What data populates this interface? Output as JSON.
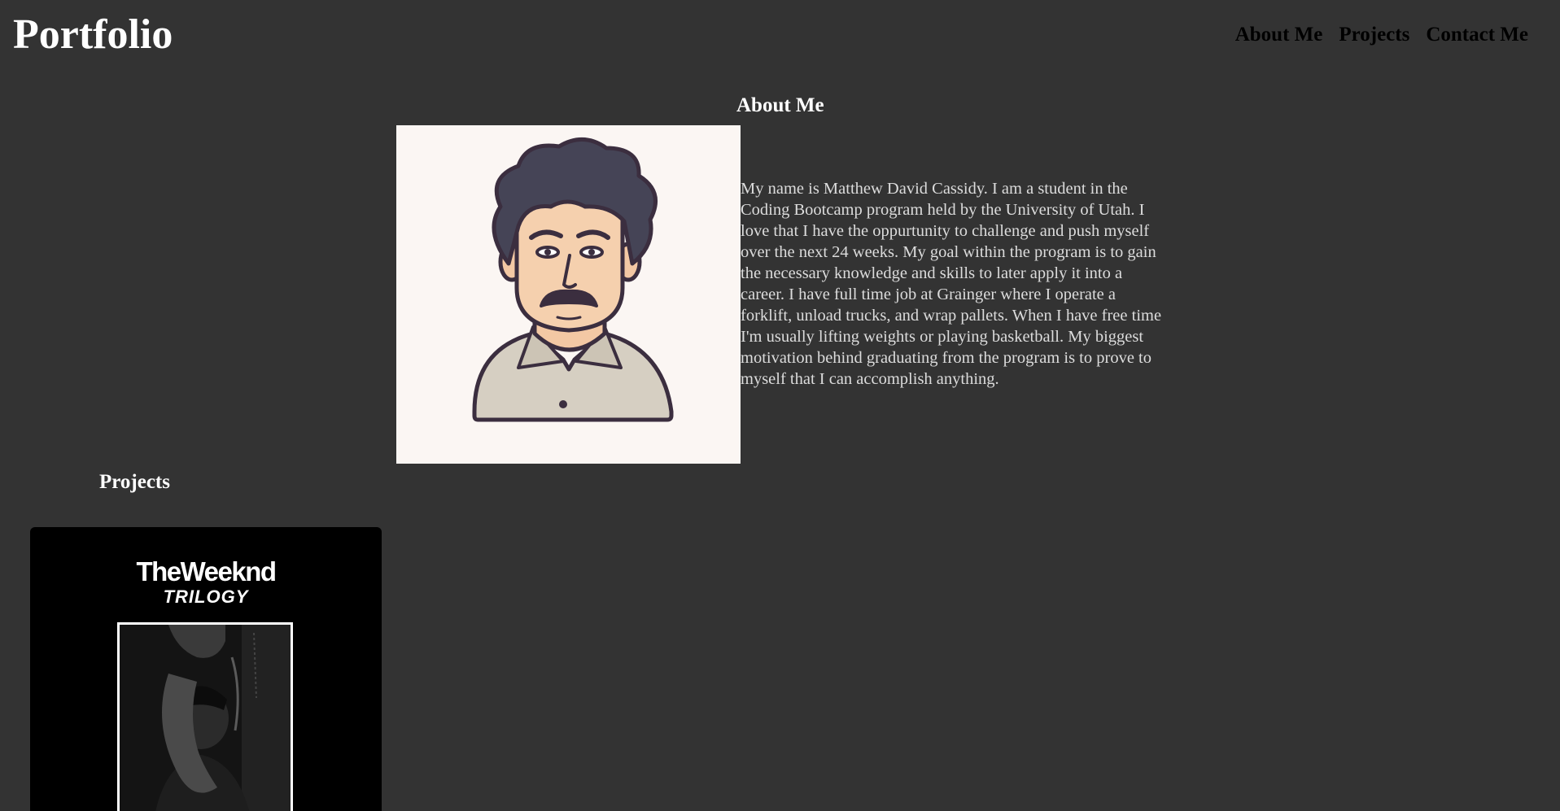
{
  "header": {
    "title": "Portfolio",
    "nav": [
      {
        "label": "About Me",
        "icon": "nav-link"
      },
      {
        "label": "Projects",
        "icon": "nav-link"
      },
      {
        "label": "Contact Me",
        "icon": "nav-link"
      }
    ]
  },
  "about": {
    "heading": "About Me",
    "avatar_icon": "cartoon-portrait-icon",
    "bio": "My name is Matthew David Cassidy. I am a student in the Coding Bootcamp program held by the University of Utah. I love that I have the oppurtunity to challenge and push myself over the next 24 weeks. My goal within the program is to gain the necessary knowledge and skills to later apply it into a career. I have full time job at Grainger where I operate a forklift, unload trucks, and wrap pallets. When I have free time I'm usually lifting weights or playing basketball. My biggest motivation behind graduating from the program is to prove to myself that I can accomplish anything."
  },
  "projects": {
    "heading": "Projects",
    "items": [
      {
        "cover_title": "TheWeeknd",
        "cover_subtitle": "TRILOGY"
      }
    ]
  },
  "colors": {
    "background": "#333333",
    "title": "#ffffff",
    "nav_text": "#000000",
    "body_text": "#dcdcdc",
    "avatar_background": "#fbf6f3"
  }
}
